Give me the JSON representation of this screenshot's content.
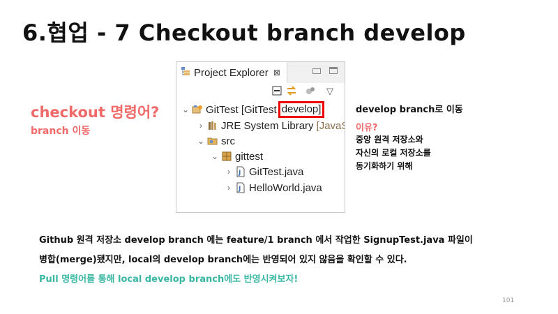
{
  "slide": {
    "title": "6.협업 - 7 Checkout branch develop",
    "question": "checkout 명령어?",
    "question_sub": "branch 이동",
    "page_number": "101"
  },
  "explorer": {
    "tab_label": "Project Explorer",
    "tab_close": "⊠",
    "tree": [
      {
        "text": "GitTest [GitTest",
        "branch": "develop]",
        "icon": "git-project-icon",
        "expand": "expanded"
      },
      {
        "text": "JRE System Library",
        "suffix": "[JavaSE",
        "icon": "library-icon",
        "expand": "collapsed"
      },
      {
        "text": "src",
        "icon": "source-folder-icon",
        "expand": "expanded"
      },
      {
        "text": "gittest",
        "icon": "package-icon",
        "expand": "expanded"
      },
      {
        "text": "GitTest.java",
        "icon": "java-file-icon",
        "expand": "collapsed"
      },
      {
        "text": "HelloWorld.java",
        "icon": "java-file-icon",
        "expand": "collapsed"
      }
    ]
  },
  "notes": {
    "title": "develop branch로 이동",
    "why": "이유?",
    "lines": [
      "중앙 원격 저장소와",
      "자신의 로컬 저장소를",
      "동기화하기 위해"
    ]
  },
  "body": {
    "line1": "Github 원격 저장소 develop branch 에는 feature/1 branch 에서 작업한 SignupTest.java 파일이",
    "line2": "병합(merge)됐지만, local의 develop branch에는 반영되어 있지 않음을 확인할 수 있다.",
    "line3": "Pull 명령어를 통해 local develop branch에도 반영시켜보자!"
  },
  "colors": {
    "accent_red": "#f06a6a",
    "accent_teal": "#3ab7a3",
    "highlight_box": "#ee0000"
  }
}
